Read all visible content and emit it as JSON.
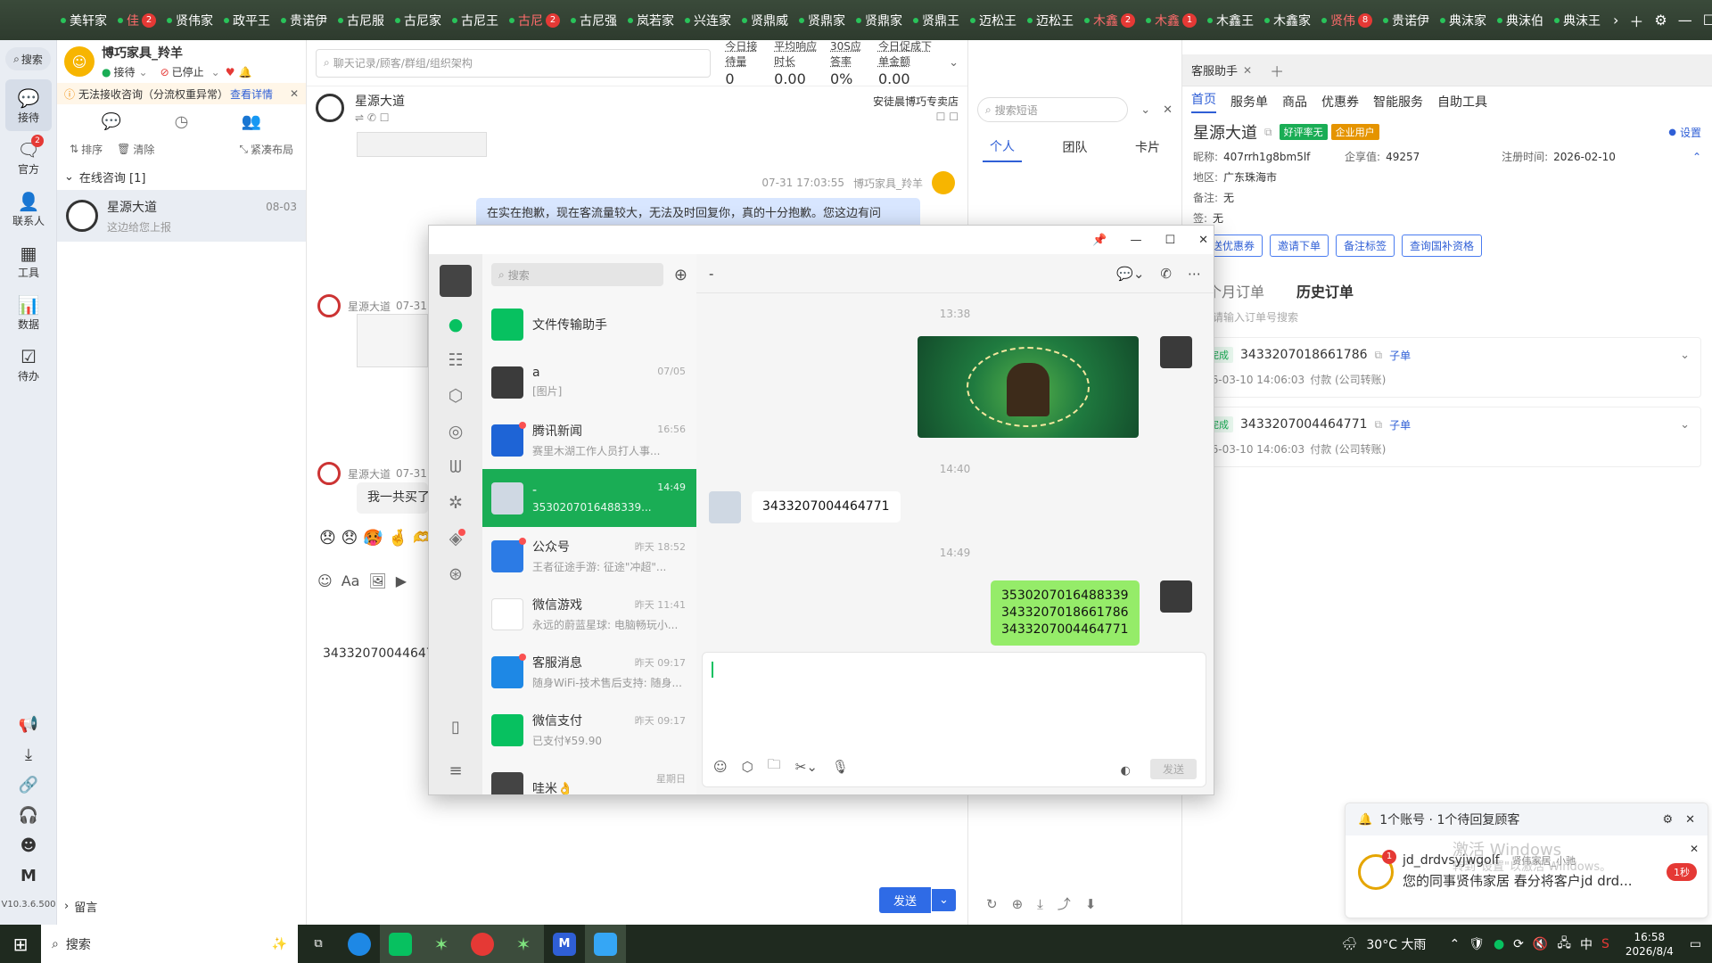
{
  "topbar": {
    "tabs": [
      {
        "label": "美轩家",
        "red": false,
        "badge": ""
      },
      {
        "label": "佳",
        "red": true,
        "badge": "2"
      },
      {
        "label": "贤伟家",
        "red": false,
        "badge": ""
      },
      {
        "label": "政平王",
        "red": false,
        "badge": ""
      },
      {
        "label": "贵诺伊",
        "red": false,
        "badge": ""
      },
      {
        "label": "古尼服",
        "red": false,
        "badge": ""
      },
      {
        "label": "古尼家",
        "red": false,
        "badge": ""
      },
      {
        "label": "古尼王",
        "red": false,
        "badge": ""
      },
      {
        "label": "古尼",
        "red": true,
        "badge": "2"
      },
      {
        "label": "古尼强",
        "red": false,
        "badge": ""
      },
      {
        "label": "岚若家",
        "red": false,
        "badge": ""
      },
      {
        "label": "兴连家",
        "red": false,
        "badge": ""
      },
      {
        "label": "贤鼎威",
        "red": false,
        "badge": ""
      },
      {
        "label": "贤鼎家",
        "red": false,
        "badge": ""
      },
      {
        "label": "贤鼎家",
        "red": false,
        "badge": ""
      },
      {
        "label": "贤鼎王",
        "red": false,
        "badge": ""
      },
      {
        "label": "迈松王",
        "red": false,
        "badge": ""
      },
      {
        "label": "迈松王",
        "red": false,
        "badge": ""
      },
      {
        "label": "木鑫",
        "red": true,
        "badge": "2"
      },
      {
        "label": "木鑫",
        "red": true,
        "badge": "1"
      },
      {
        "label": "木鑫王",
        "red": false,
        "badge": ""
      },
      {
        "label": "木鑫家",
        "red": false,
        "badge": ""
      },
      {
        "label": "贤伟",
        "red": true,
        "badge": "8"
      },
      {
        "label": "贵诺伊",
        "red": false,
        "badge": ""
      },
      {
        "label": "典沫家",
        "red": false,
        "badge": ""
      },
      {
        "label": "典沫伯",
        "red": false,
        "badge": ""
      },
      {
        "label": "典沫王",
        "red": false,
        "badge": ""
      }
    ],
    "more_icon": "chevron-right-icon",
    "add_icon": "plus-icon"
  },
  "rail": {
    "search_label": "搜索",
    "items": [
      {
        "label": "接待",
        "icon": "chat-icon"
      },
      {
        "label": "官方",
        "icon": "official-icon",
        "badge": "2"
      },
      {
        "label": "联系人",
        "icon": "contact-icon"
      },
      {
        "label": "工具",
        "icon": "tools-icon"
      },
      {
        "label": "数据",
        "icon": "data-icon"
      },
      {
        "label": "待办",
        "icon": "todo-icon"
      }
    ],
    "version": "V10.3.6.500"
  },
  "account": {
    "name": "博巧家具_羚羊",
    "status1": "接待",
    "status2": "已停止",
    "warning": "无法接收咨询（分流权重异常）",
    "warning_link": "查看详情",
    "sort_label": "排序",
    "clear_label": "清除",
    "layout_label": "紧凑布局",
    "online_group": "在线咨询 [1]",
    "session": {
      "name": "星源大道",
      "date": "08-03",
      "preview": "这边给您上报"
    },
    "leave_msg": "留言"
  },
  "chat": {
    "search_placeholder": "聊天记录/顾客/群组/组织架构",
    "stats": [
      {
        "label": "今日接待量",
        "value": "0"
      },
      {
        "label": "平均响应时长",
        "value": "0.00"
      },
      {
        "label": "30S应答率",
        "value": "0%"
      },
      {
        "label": "今日促成下单金额",
        "value": "0.00"
      }
    ],
    "customer": "星源大道",
    "shop": "安徒晨博巧专卖店",
    "msg_time": "07-31 17:03:55",
    "msg_sender": "博巧家具_羚羊",
    "msg_text": "在实在抱歉，现在客流量较大，无法及时回复你，真的十分抱歉。您这边有问",
    "cust_label": "星源大道",
    "cust_time": "07-31",
    "cust_msg": "我一共买了3",
    "input_text": "3433207004464771",
    "send_label": "发送"
  },
  "quick": {
    "search_placeholder": "搜索短语",
    "tabs": [
      "个人",
      "团队",
      "卡片"
    ]
  },
  "assistant": {
    "tab": "客服助手",
    "nav": [
      "首页",
      "服务单",
      "商品",
      "优惠券",
      "智能服务",
      "自助工具"
    ],
    "customer": "星源大道",
    "tag1": "好评率无",
    "tag2": "企业用户",
    "settings": "设置",
    "nick_label": "昵称:",
    "nick": "407rrh1g8bm5lf",
    "value_label": "企享值:",
    "value": "49257",
    "reg_label": "注册时间:",
    "reg": "2026-02-10",
    "region_label": "地区:",
    "region": "广东珠海市",
    "note_label": "备注:",
    "note": "无",
    "note2_label": "签:",
    "note2": "无",
    "buttons": [
      "发送优惠券",
      "邀请下单",
      "备注标签",
      "查询国补资格"
    ],
    "order_tabs": [
      "三个月订单",
      "历史订单"
    ],
    "order_search": "请输入订单号搜索",
    "orders": [
      {
        "status": "完成",
        "id": "3433207018661786",
        "sub": "子单",
        "time": "26-03-10 14:06:03",
        "pay": "付款 (公司转账)"
      },
      {
        "status": "完成",
        "id": "3433207004464771",
        "sub": "子单",
        "time": "26-03-10 14:06:03",
        "pay": "付款 (公司转账)"
      }
    ],
    "notify_title": "1个账号 · 1个待回复顾客",
    "notify_user": "jd_drdvsyjwgolf",
    "notify_shop": "贤伟家居_小驰",
    "notify_msg": "您的同事贤伟家居 春分将客户jd drd...",
    "notify_badge": "1秒",
    "activate1": "激活 Windows",
    "activate2": "转到\"设置\"以激活 Windows。"
  },
  "wechat": {
    "search_placeholder": "搜索",
    "chat_title": "-",
    "chats": [
      {
        "name": "文件传输助手",
        "preview": "",
        "time": "",
        "color": "#07c160",
        "dot": false,
        "selected": false
      },
      {
        "name": "a",
        "preview": "[图片]",
        "time": "07/05",
        "color": "#3b3b3b",
        "dot": false,
        "selected": false
      },
      {
        "name": "腾讯新闻",
        "preview": "赛里木湖工作人员打人事...",
        "time": "16:56",
        "color": "#1e64d6",
        "dot": true,
        "selected": false
      },
      {
        "name": "-",
        "preview": "3530207016488339...",
        "time": "14:49",
        "color": "#cfd8e3",
        "dot": false,
        "selected": true
      },
      {
        "name": "公众号",
        "preview": "王者征途手游: 征途\"冲超\"...",
        "time": "昨天 18:52",
        "color": "#2c7be5",
        "dot": true,
        "selected": false
      },
      {
        "name": "微信游戏",
        "preview": "永远的蔚蓝星球: 电脑畅玩小...",
        "time": "昨天 11:41",
        "color": "#ffffff",
        "dot": false,
        "selected": false
      },
      {
        "name": "客服消息",
        "preview": "随身WiFi-技术售后支持: 随身...",
        "time": "昨天 09:17",
        "color": "#1e88e5",
        "dot": true,
        "selected": false
      },
      {
        "name": "微信支付",
        "preview": "已支付¥59.90",
        "time": "昨天 09:17",
        "color": "#07c160",
        "dot": false,
        "selected": false
      },
      {
        "name": "哇米👌",
        "preview": "",
        "time": "星期日",
        "color": "#444444",
        "dot": false,
        "selected": false
      }
    ],
    "times": [
      "13:38",
      "14:40",
      "14:49"
    ],
    "recv_msg": "3433207004464771",
    "sent_msg1": "3530207016488339",
    "sent_msg2": "3433207018661786",
    "sent_msg3": "3433207004464771",
    "send_label": "发送"
  },
  "taskbar": {
    "search_placeholder": "搜索",
    "weather": "30°C 大雨",
    "ime": "中",
    "time": "16:58",
    "date": "2026/8/4"
  }
}
